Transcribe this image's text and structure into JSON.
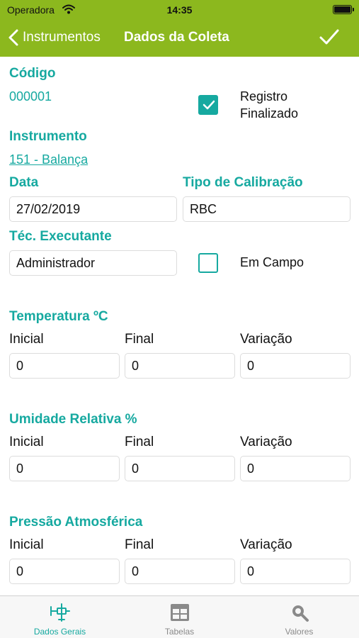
{
  "status_bar": {
    "carrier": "Operadora",
    "time": "14:35"
  },
  "nav": {
    "back_label": "Instrumentos",
    "title": "Dados da Coleta"
  },
  "form": {
    "codigo_label": "Código",
    "codigo_value": "000001",
    "registro_label_line1": "Registro",
    "registro_label_line2": "Finalizado",
    "registro_checked": true,
    "instrumento_label": "Instrumento",
    "instrumento_value": "151 - Balança",
    "data_label": "Data",
    "data_value": "27/02/2019",
    "tipo_label": "Tipo de Calibração",
    "tipo_value": "RBC",
    "tecnico_label": "Téc. Executante",
    "tecnico_value": "Administrador",
    "em_campo_label": "Em Campo",
    "em_campo_checked": false
  },
  "temperatura": {
    "title": "Temperatura ºC",
    "inicial_label": "Inicial",
    "final_label": "Final",
    "variacao_label": "Variação",
    "inicial": "0",
    "final": "0",
    "variacao": "0"
  },
  "umidade": {
    "title": "Umidade Relativa %",
    "inicial_label": "Inicial",
    "final_label": "Final",
    "variacao_label": "Variação",
    "inicial": "0",
    "final": "0",
    "variacao": "0"
  },
  "pressao": {
    "title": "Pressão Atmosférica",
    "inicial_label": "Inicial",
    "final_label": "Final",
    "variacao_label": "Variação",
    "inicial": "0",
    "final": "0",
    "variacao": "0"
  },
  "tabs": [
    {
      "label": "Dados Gerais",
      "icon": "caliper-icon",
      "active": true
    },
    {
      "label": "Tabelas",
      "icon": "table-icon",
      "active": false
    },
    {
      "label": "Valores",
      "icon": "search-icon",
      "active": false
    }
  ],
  "colors": {
    "accent": "#8cb81e",
    "teal": "#16a9a0",
    "tab_inactive": "#8a8a8a"
  }
}
